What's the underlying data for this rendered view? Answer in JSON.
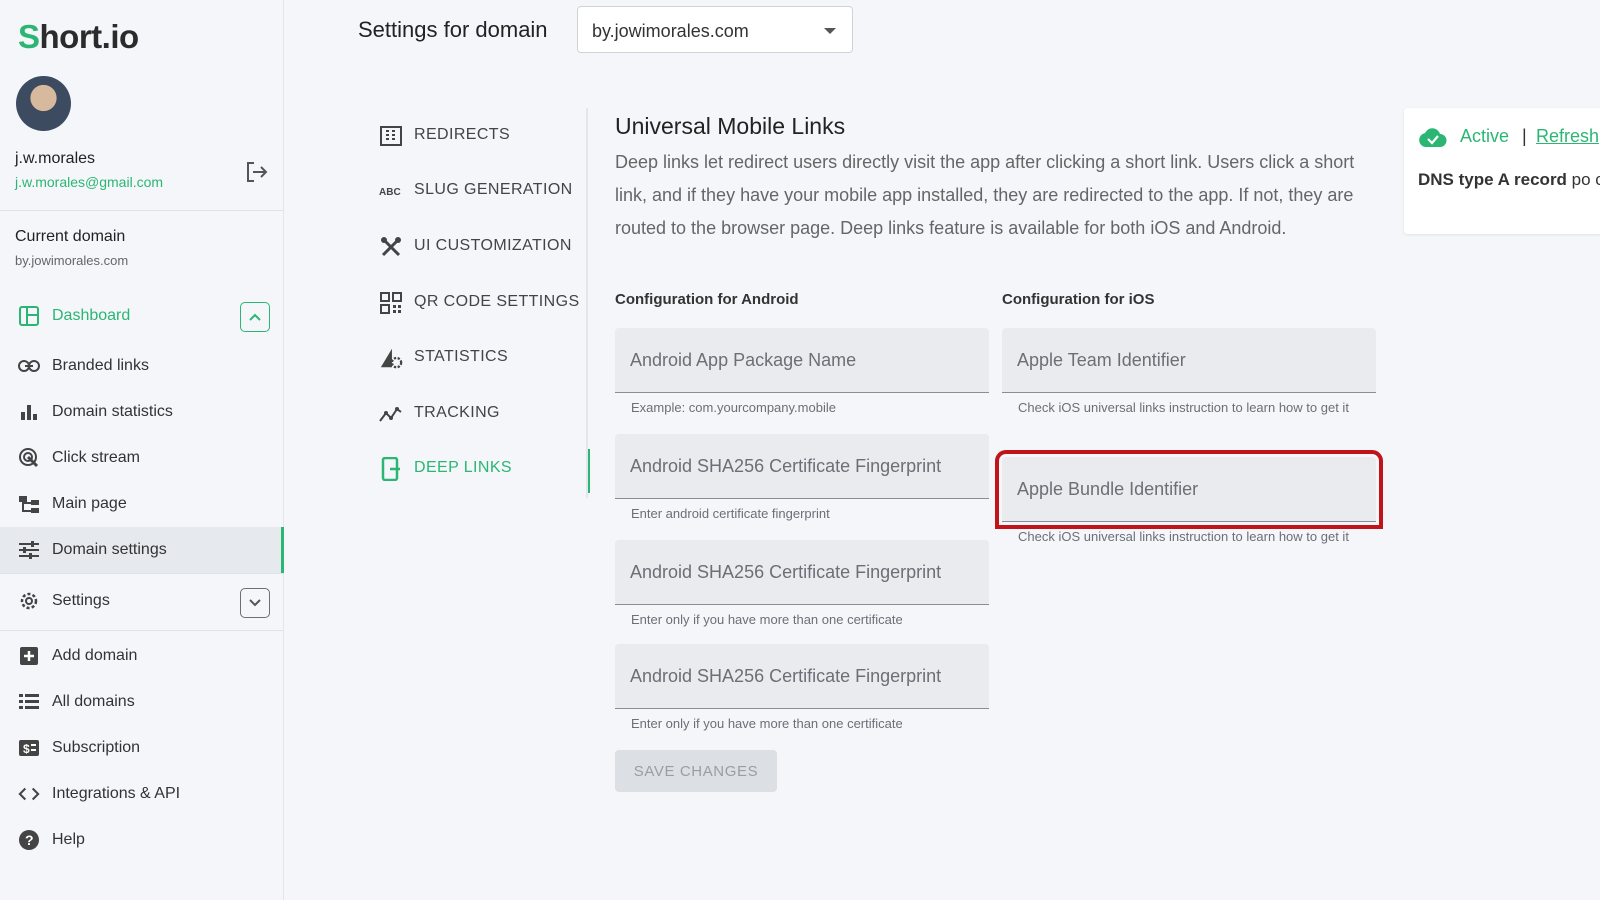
{
  "brand": {
    "logo_first": "S",
    "logo_rest": "hort.io"
  },
  "user": {
    "name": "j.w.morales",
    "email": "j.w.morales@gmail.com"
  },
  "current_domain": {
    "label": "Current domain",
    "value": "by.jowimorales.com"
  },
  "sidebar": {
    "items": [
      {
        "label": "Dashboard",
        "icon": "dashboard-icon"
      },
      {
        "label": "Branded links",
        "icon": "link-icon"
      },
      {
        "label": "Domain statistics",
        "icon": "bar-chart-icon"
      },
      {
        "label": "Click stream",
        "icon": "click-icon"
      },
      {
        "label": "Main page",
        "icon": "sitemap-icon"
      },
      {
        "label": "Domain settings",
        "icon": "sliders-icon"
      },
      {
        "label": "Settings",
        "icon": "gear-icon"
      },
      {
        "label": "Add domain",
        "icon": "plus-square-icon"
      },
      {
        "label": "All domains",
        "icon": "list-icon"
      },
      {
        "label": "Subscription",
        "icon": "dollar-icon"
      },
      {
        "label": "Integrations & API",
        "icon": "code-icon"
      },
      {
        "label": "Help",
        "icon": "help-icon"
      }
    ]
  },
  "header": {
    "title": "Settings for domain",
    "domain": "by.jowimorales.com"
  },
  "subnav": {
    "items": [
      {
        "label": "REDIRECTS",
        "icon": "building-icon"
      },
      {
        "label": "SLUG GENERATION",
        "icon": "abc-icon"
      },
      {
        "label": "UI CUSTOMIZATION",
        "icon": "tools-icon"
      },
      {
        "label": "QR CODE SETTINGS",
        "icon": "qr-icon"
      },
      {
        "label": "STATISTICS",
        "icon": "statistics-icon"
      },
      {
        "label": "TRACKING",
        "icon": "tracking-icon"
      },
      {
        "label": "DEEP LINKS",
        "icon": "mobile-link-icon"
      }
    ]
  },
  "main": {
    "title": "Universal Mobile Links",
    "description": "Deep links let redirect users directly visit the app after clicking a short link. Users click a short link, and if they have your mobile app installed, they are redirected to the app. If not, they are routed to the browser page. Deep links feature is available for both iOS and Android.",
    "android": {
      "heading": "Configuration for Android",
      "fields": [
        {
          "placeholder": "Android App Package Name",
          "helper": "Example: com.yourcompany.mobile"
        },
        {
          "placeholder": "Android SHA256 Certificate Fingerprint",
          "helper": "Enter android certificate fingerprint"
        },
        {
          "placeholder": "Android SHA256 Certificate Fingerprint",
          "helper": "Enter only if you have more than one certificate"
        },
        {
          "placeholder": "Android SHA256 Certificate Fingerprint",
          "helper": "Enter only if you have more than one certificate"
        }
      ]
    },
    "ios": {
      "heading": "Configuration for iOS",
      "fields": [
        {
          "placeholder": "Apple Team Identifier",
          "helper": "Check iOS universal links instruction to learn how to get it"
        },
        {
          "placeholder": "Apple Bundle Identifier",
          "helper": "Check iOS universal links instruction to learn how to get it"
        }
      ]
    },
    "save_label": "SAVE CHANGES"
  },
  "status": {
    "active": "Active",
    "separator": "|",
    "refresh": "Refresh",
    "dns_bold": "DNS type A record",
    "dns_rest": " po correct IP address"
  },
  "colors": {
    "accent": "#2bb673",
    "highlight": "#c0141a"
  }
}
